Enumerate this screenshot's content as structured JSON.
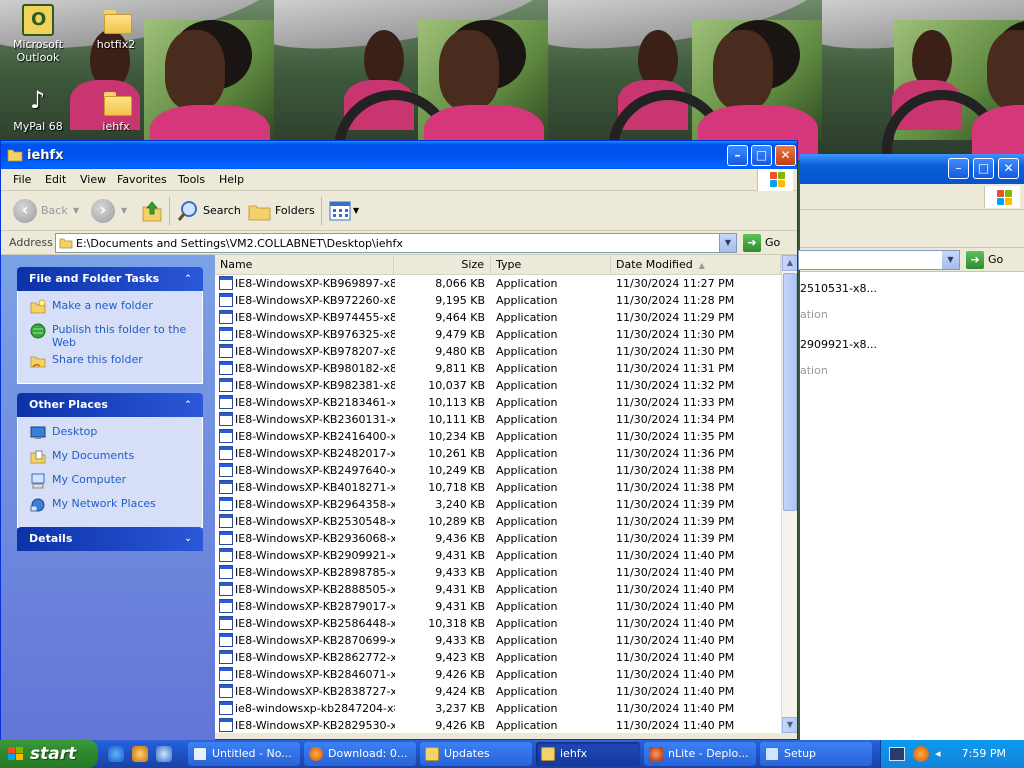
{
  "desktop": {
    "icons": [
      {
        "label": "Microsoft Outlook",
        "icon": "outlook-icon"
      },
      {
        "label": "hotfix2",
        "icon": "folder-icon"
      },
      {
        "label": "MyPal 68",
        "icon": "mypal-icon"
      },
      {
        "label": "iehfx",
        "icon": "folder-icon"
      }
    ]
  },
  "window": {
    "title": "iehfx",
    "menu": [
      "File",
      "Edit",
      "View",
      "Favorites",
      "Tools",
      "Help"
    ],
    "toolbar": {
      "back": "Back",
      "search": "Search",
      "folders": "Folders"
    },
    "address": {
      "label": "Address",
      "value": "E:\\Documents and Settings\\VM2.COLLABNET\\Desktop\\iehfx",
      "go": "Go"
    }
  },
  "taskpane": {
    "file_tasks": {
      "title": "File and Folder Tasks",
      "items": [
        "Make a new folder",
        "Publish this folder to the Web",
        "Share this folder"
      ]
    },
    "other_places": {
      "title": "Other Places",
      "items": [
        "Desktop",
        "My Documents",
        "My Computer",
        "My Network Places"
      ]
    },
    "details": {
      "title": "Details"
    }
  },
  "filelist": {
    "columns": {
      "name": "Name",
      "size": "Size",
      "type": "Type",
      "date": "Date Modified"
    },
    "rows": [
      {
        "name": "IE8-WindowsXP-KB969897-x8...",
        "size": "8,066 KB",
        "type": "Application",
        "date": "11/30/2024 11:27 PM"
      },
      {
        "name": "IE8-WindowsXP-KB972260-x8...",
        "size": "9,195 KB",
        "type": "Application",
        "date": "11/30/2024 11:28 PM"
      },
      {
        "name": "IE8-WindowsXP-KB974455-x8...",
        "size": "9,464 KB",
        "type": "Application",
        "date": "11/30/2024 11:29 PM"
      },
      {
        "name": "IE8-WindowsXP-KB976325-x8...",
        "size": "9,479 KB",
        "type": "Application",
        "date": "11/30/2024 11:30 PM"
      },
      {
        "name": "IE8-WindowsXP-KB978207-x8...",
        "size": "9,480 KB",
        "type": "Application",
        "date": "11/30/2024 11:30 PM"
      },
      {
        "name": "IE8-WindowsXP-KB980182-x8...",
        "size": "9,811 KB",
        "type": "Application",
        "date": "11/30/2024 11:31 PM"
      },
      {
        "name": "IE8-WindowsXP-KB982381-x8...",
        "size": "10,037 KB",
        "type": "Application",
        "date": "11/30/2024 11:32 PM"
      },
      {
        "name": "IE8-WindowsXP-KB2183461-x...",
        "size": "10,113 KB",
        "type": "Application",
        "date": "11/30/2024 11:33 PM"
      },
      {
        "name": "IE8-WindowsXP-KB2360131-x...",
        "size": "10,111 KB",
        "type": "Application",
        "date": "11/30/2024 11:34 PM"
      },
      {
        "name": "IE8-WindowsXP-KB2416400-x...",
        "size": "10,234 KB",
        "type": "Application",
        "date": "11/30/2024 11:35 PM"
      },
      {
        "name": "IE8-WindowsXP-KB2482017-x...",
        "size": "10,261 KB",
        "type": "Application",
        "date": "11/30/2024 11:36 PM"
      },
      {
        "name": "IE8-WindowsXP-KB2497640-x...",
        "size": "10,249 KB",
        "type": "Application",
        "date": "11/30/2024 11:38 PM"
      },
      {
        "name": "IE8-WindowsXP-KB4018271-x...",
        "size": "10,718 KB",
        "type": "Application",
        "date": "11/30/2024 11:38 PM"
      },
      {
        "name": "IE8-WindowsXP-KB2964358-x...",
        "size": "3,240 KB",
        "type": "Application",
        "date": "11/30/2024 11:39 PM"
      },
      {
        "name": "IE8-WindowsXP-KB2530548-x...",
        "size": "10,289 KB",
        "type": "Application",
        "date": "11/30/2024 11:39 PM"
      },
      {
        "name": "IE8-WindowsXP-KB2936068-x...",
        "size": "9,436 KB",
        "type": "Application",
        "date": "11/30/2024 11:39 PM"
      },
      {
        "name": "IE8-WindowsXP-KB2909921-x...",
        "size": "9,431 KB",
        "type": "Application",
        "date": "11/30/2024 11:40 PM"
      },
      {
        "name": "IE8-WindowsXP-KB2898785-x...",
        "size": "9,433 KB",
        "type": "Application",
        "date": "11/30/2024 11:40 PM"
      },
      {
        "name": "IE8-WindowsXP-KB2888505-x...",
        "size": "9,431 KB",
        "type": "Application",
        "date": "11/30/2024 11:40 PM"
      },
      {
        "name": "IE8-WindowsXP-KB2879017-x...",
        "size": "9,431 KB",
        "type": "Application",
        "date": "11/30/2024 11:40 PM"
      },
      {
        "name": "IE8-WindowsXP-KB2586448-x...",
        "size": "10,318 KB",
        "type": "Application",
        "date": "11/30/2024 11:40 PM"
      },
      {
        "name": "IE8-WindowsXP-KB2870699-x...",
        "size": "9,433 KB",
        "type": "Application",
        "date": "11/30/2024 11:40 PM"
      },
      {
        "name": "IE8-WindowsXP-KB2862772-x...",
        "size": "9,423 KB",
        "type": "Application",
        "date": "11/30/2024 11:40 PM"
      },
      {
        "name": "IE8-WindowsXP-KB2846071-x...",
        "size": "9,426 KB",
        "type": "Application",
        "date": "11/30/2024 11:40 PM"
      },
      {
        "name": "IE8-WindowsXP-KB2838727-x...",
        "size": "9,424 KB",
        "type": "Application",
        "date": "11/30/2024 11:40 PM"
      },
      {
        "name": "ie8-windowsxp-kb2847204-x8...",
        "size": "3,237 KB",
        "type": "Application",
        "date": "11/30/2024 11:40 PM"
      },
      {
        "name": "IE8-WindowsXP-KB2829530-x...",
        "size": "9,426 KB",
        "type": "Application",
        "date": "11/30/2024 11:40 PM"
      }
    ]
  },
  "back_window": {
    "go": "Go",
    "entries": [
      {
        "name": "2510531-x8...",
        "type": "ation"
      },
      {
        "name": "2909921-x8...",
        "type": "ation"
      }
    ]
  },
  "taskbar": {
    "start": "start",
    "tasks": [
      {
        "label": "Untitled - No...",
        "icon": "notepad-icon"
      },
      {
        "label": "Download: 0...",
        "icon": "firefox-icon"
      },
      {
        "label": "Updates",
        "icon": "folder-icon"
      },
      {
        "label": "iehfx",
        "icon": "folder-icon"
      },
      {
        "label": "nLite - Deplo...",
        "icon": "nlite-icon"
      },
      {
        "label": "Setup",
        "icon": "setup-icon"
      }
    ],
    "clock": "7:59 PM"
  }
}
